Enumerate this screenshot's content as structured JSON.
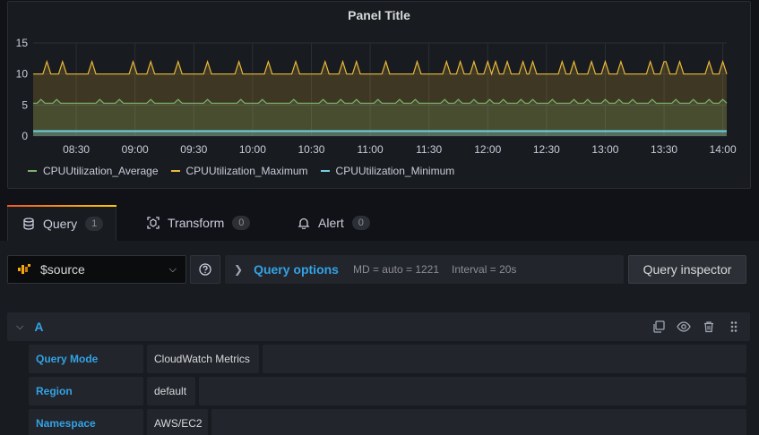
{
  "panel": {
    "title": "Panel Title"
  },
  "chart_data": {
    "type": "line",
    "x_ticks": [
      "08:30",
      "09:00",
      "09:30",
      "10:00",
      "10:30",
      "11:00",
      "11:30",
      "12:00",
      "12:30",
      "13:00",
      "13:30",
      "14:00"
    ],
    "y_ticks": [
      0,
      5,
      10,
      15
    ],
    "ylim": [
      0,
      15
    ],
    "xlim": [
      "08:08",
      "14:02"
    ],
    "grid": true,
    "legend_placement": "bottom-left",
    "series": [
      {
        "name": "CPUUtilization_Average",
        "color": "#7eb26d",
        "baseline": 5.3,
        "spike_height": 5.9,
        "spikes_at": [
          "08:12",
          "08:20",
          "08:42",
          "08:52",
          "09:08",
          "09:22",
          "09:37",
          "09:54",
          "10:05",
          "10:21",
          "10:36",
          "10:45",
          "10:53",
          "11:04",
          "11:15",
          "11:23",
          "11:38",
          "11:45",
          "11:53",
          "12:01",
          "12:08",
          "12:17",
          "12:23",
          "12:33",
          "12:44",
          "12:51",
          "13:00",
          "13:07",
          "13:14",
          "13:24",
          "13:36",
          "13:45",
          "13:53",
          "14:00"
        ]
      },
      {
        "name": "CPUUtilization_Maximum",
        "color": "#eab839",
        "baseline": 10,
        "spike_height": 12,
        "spikes_at": [
          "08:15",
          "08:23",
          "08:38",
          "08:59",
          "09:08",
          "09:22",
          "09:37",
          "09:53",
          "10:08",
          "10:22",
          "10:37",
          "10:46",
          "10:53",
          "11:08",
          "11:24",
          "11:39",
          "11:46",
          "11:53",
          "12:00",
          "12:04",
          "12:10",
          "12:18",
          "12:23",
          "12:38",
          "12:44",
          "12:53",
          "13:00",
          "13:08",
          "13:23",
          "13:30",
          "13:31",
          "13:38",
          "13:53",
          "14:00"
        ]
      },
      {
        "name": "CPUUtilization_Minimum",
        "color": "#6ed0e0",
        "baseline": 0.8
      }
    ]
  },
  "tabs": [
    {
      "label": "Query",
      "count": "1",
      "icon": "database-icon"
    },
    {
      "label": "Transform",
      "count": "0",
      "icon": "transform-icon"
    },
    {
      "label": "Alert",
      "count": "0",
      "icon": "bell-icon"
    }
  ],
  "editor": {
    "source_value": "$source",
    "query_options_label": "Query options",
    "md_info": "MD = auto = 1221",
    "interval_info": "Interval = 20s",
    "inspector_label": "Query inspector",
    "query": {
      "ref_id": "A",
      "fields": [
        {
          "label": "Query Mode",
          "value": "CloudWatch Metrics"
        },
        {
          "label": "Region",
          "value": "default"
        },
        {
          "label": "Namespace",
          "value": "AWS/EC2"
        }
      ]
    }
  },
  "colors": {
    "accent_blue": "#33a2e5",
    "brand_gradient_start": "#f05a28",
    "brand_gradient_end": "#fbca0a"
  }
}
